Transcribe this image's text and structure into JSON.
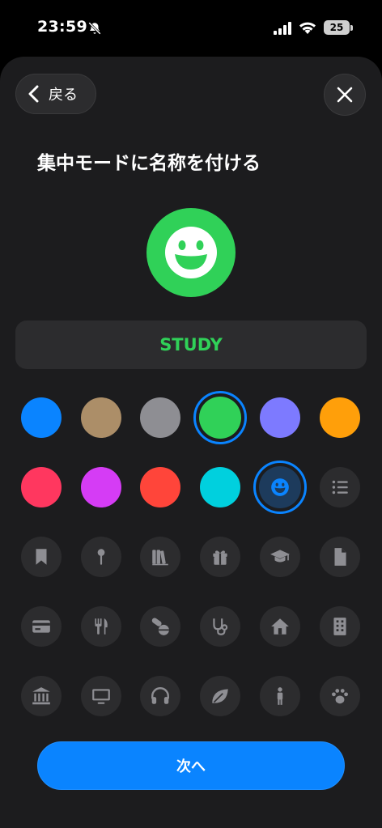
{
  "status_bar": {
    "time": "23:59",
    "battery": "25"
  },
  "nav": {
    "back_label": "戻る"
  },
  "title": "集中モードに名称を付ける",
  "focus": {
    "name": "STUDY",
    "color": "#30d158",
    "icon": "smiley-icon"
  },
  "colors": [
    "#0a84ff",
    "#ac8e68",
    "#8e8e93",
    "#30d158",
    "#7d7aff",
    "#ff9f0a",
    "#ff375f",
    "#d53cf5",
    "#ff453a",
    "#00d0de"
  ],
  "selected_color_index": 3,
  "glyphs": [
    "smiley-icon",
    "list-icon",
    "bookmark-icon",
    "pin-icon",
    "books-icon",
    "gift-icon",
    "graduation-cap-icon",
    "document-icon",
    "credit-card-icon",
    "fork-knife-icon",
    "pills-icon",
    "stethoscope-icon",
    "house-icon",
    "building-icon",
    "bank-icon",
    "tv-icon",
    "headphones-icon",
    "leaf-icon",
    "person-icon",
    "paw-icon"
  ],
  "selected_glyph": "smiley-icon",
  "next_label": "次へ"
}
